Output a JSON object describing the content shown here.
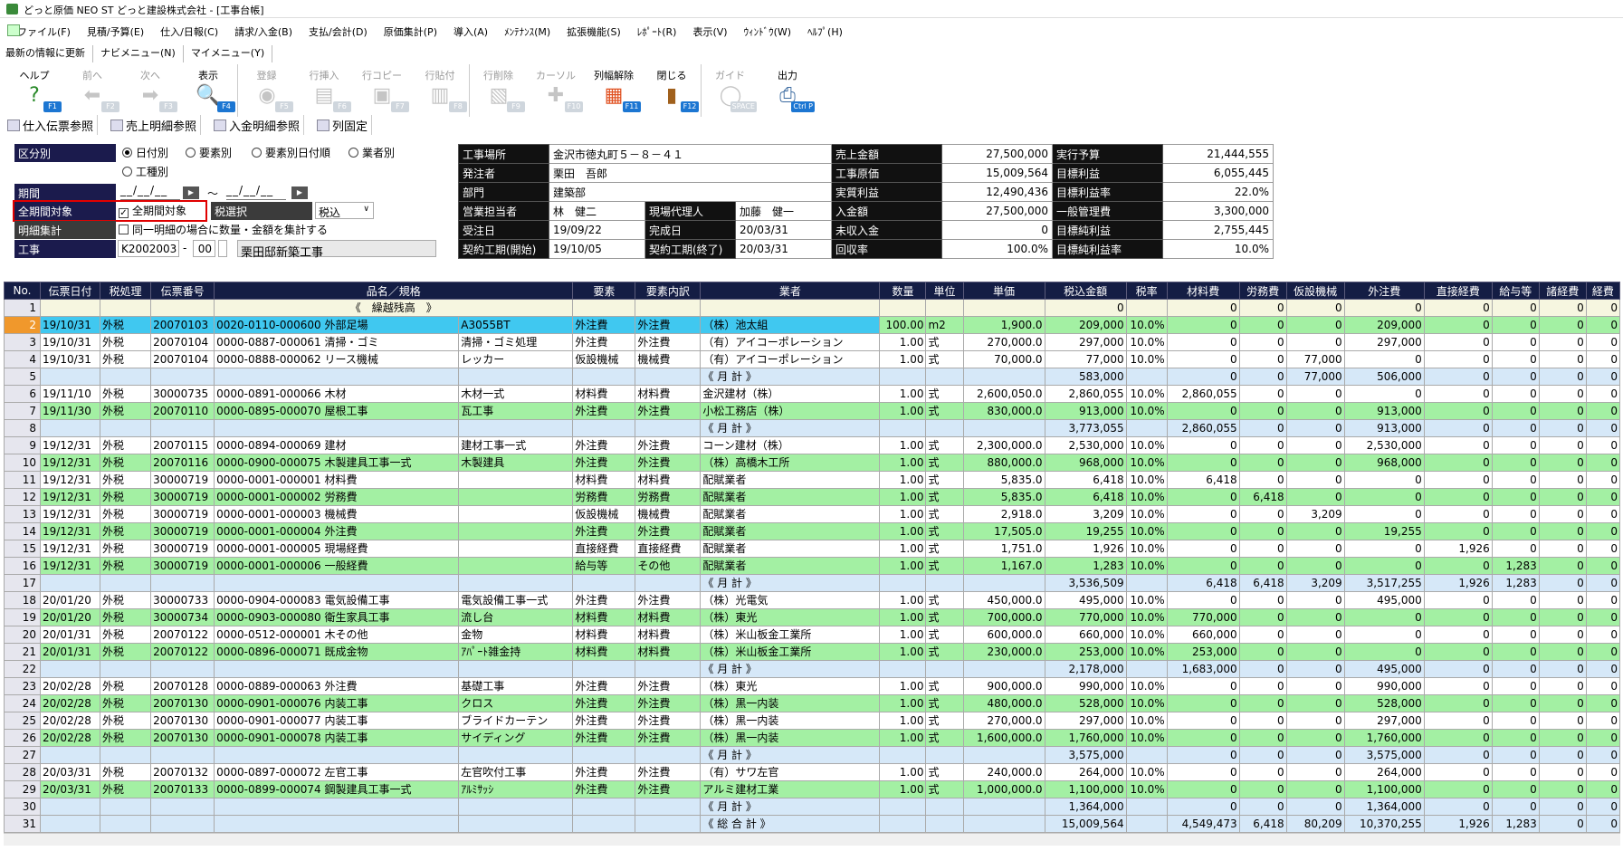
{
  "window": {
    "title": "どっと原価 NEO ST どっと建設株式会社 - [工事台帳]"
  },
  "menu": [
    "ファイル(F)",
    "見積/予算(E)",
    "仕入/日報(C)",
    "請求/入金(B)",
    "支払/会計(D)",
    "原価集計(P)",
    "導入(A)",
    "ﾒﾝﾃﾅﾝｽ(M)",
    "拡張機能(S)",
    "ﾚﾎﾟｰﾄ(R)",
    "表示(V)",
    "ｳｨﾝﾄﾞｳ(W)",
    "ﾍﾙﾌﾟ(H)"
  ],
  "nav": [
    "最新の情報に更新",
    "ナビメニュー(N)",
    "マイメニュー(Y)"
  ],
  "toolbar": [
    {
      "label": "ヘルプ",
      "key": "F1",
      "icon": "help-icon",
      "enabled": true
    },
    {
      "label": "前へ",
      "key": "F2",
      "icon": "back-arrow-icon",
      "enabled": false
    },
    {
      "label": "次へ",
      "key": "F3",
      "icon": "forward-arrow-icon",
      "enabled": false
    },
    {
      "label": "表示",
      "key": "F4",
      "icon": "magnifier-icon",
      "enabled": true
    },
    {
      "label": "登録",
      "key": "F5",
      "icon": "disk-icon",
      "enabled": false
    },
    {
      "label": "行挿入",
      "key": "F6",
      "icon": "row-insert-icon",
      "enabled": false
    },
    {
      "label": "行コピー",
      "key": "F7",
      "icon": "row-copy-icon",
      "enabled": false
    },
    {
      "label": "行貼付",
      "key": "F8",
      "icon": "row-paste-icon",
      "enabled": false
    },
    {
      "label": "行削除",
      "key": "F9",
      "icon": "row-delete-icon",
      "enabled": false
    },
    {
      "label": "カーソル",
      "key": "F10",
      "icon": "cursor-icon",
      "enabled": false
    },
    {
      "label": "列幅解除",
      "key": "F11",
      "icon": "column-width-icon",
      "enabled": true
    },
    {
      "label": "閉じる",
      "key": "F12",
      "icon": "door-icon",
      "enabled": true
    },
    {
      "label": "ガイド",
      "key": "SPACE",
      "icon": "lightbulb-icon",
      "enabled": false
    },
    {
      "label": "出力",
      "key": "Ctrl P",
      "icon": "printer-icon",
      "enabled": true
    }
  ],
  "subbar": [
    "仕入伝票参照",
    "売上明細参照",
    "入金明細参照",
    "列固定"
  ],
  "filters": {
    "kubun_label": "区分別",
    "kubun_options": [
      "日付別",
      "要素別",
      "要素別日付順",
      "業者別",
      "工種別"
    ],
    "kubun_selected": "日付別",
    "kikan_label": "期間",
    "date_from": "__/__/__",
    "date_to": "__/__/__",
    "tilde": "～",
    "zenkikan_label": "全期間対象",
    "zenkikan_check": "全期間対象",
    "zeisentaku_label": "税選択",
    "zeisentaku_value": "税込",
    "meisai_label": "明細集計",
    "meisai_check": "同一明細の場合に数量・金額を集計する",
    "koji_label": "工事",
    "koji_code": "K2002003",
    "koji_dash": "-",
    "koji_sub": "00",
    "koji_name": "栗田邸新築工事"
  },
  "info": {
    "rows": [
      [
        "工事場所",
        "金沢市徳丸町５－８－４１",
        "",
        "",
        "売上金額",
        "27,500,000",
        "実行予算",
        "21,444,555"
      ],
      [
        "発注者",
        "栗田　吾郎",
        "",
        "",
        "工事原価",
        "15,009,564",
        "目標利益",
        "6,055,445"
      ],
      [
        "部門",
        "建築部",
        "",
        "",
        "実質利益",
        "12,490,436",
        "目標利益率",
        "22.0%"
      ],
      [
        "営業担当者",
        "林　健二",
        "現場代理人",
        "加藤　健一",
        "入金額",
        "27,500,000",
        "一般管理費",
        "3,300,000"
      ],
      [
        "受注日",
        "19/09/22",
        "完成日",
        "20/03/31",
        "未収入金",
        "0",
        "目標純利益",
        "2,755,445"
      ],
      [
        "契約工期(開始)",
        "19/10/05",
        "契約工期(終了)",
        "20/03/31",
        "回収率",
        "100.0%",
        "目標純利益率",
        "10.0%"
      ]
    ]
  },
  "grid": {
    "headers": [
      "No.",
      "伝票日付",
      "税処理",
      "伝票番号",
      "品名／規格",
      "",
      "要素",
      "要素内訳",
      "業者",
      "数量",
      "単位",
      "単価",
      "税込金額",
      "税率",
      "材料費",
      "労務費",
      "仮設機械",
      "外注費",
      "直接経費",
      "給与等",
      "諸経費",
      "経費"
    ],
    "rows": [
      {
        "t": "c",
        "v": [
          "1",
          "",
          "",
          "",
          "",
          "《　繰越残高　》",
          "",
          "",
          "",
          "",
          "",
          "",
          "0",
          "",
          "0",
          "0",
          "0",
          "0",
          "0",
          "0",
          "0",
          "0"
        ]
      },
      {
        "t": "sel",
        "v": [
          "2",
          "19/10/31",
          "外税",
          "20070103",
          "0020-0110-000600 外部足場",
          "A3055BT",
          "外注費",
          "外注費",
          "（株）池太組",
          "100.00",
          "m2",
          "1,900.0",
          "209,000",
          "10.0%",
          "0",
          "0",
          "0",
          "209,000",
          "0",
          "0",
          "0",
          "0"
        ]
      },
      {
        "t": "w",
        "v": [
          "3",
          "19/10/31",
          "外税",
          "20070104",
          "0000-0887-000061 清掃・ゴミ",
          "清掃・ゴミ処理",
          "外注費",
          "外注費",
          "（有）アイコーポレーション",
          "1.00",
          "式",
          "270,000.0",
          "297,000",
          "10.0%",
          "0",
          "0",
          "0",
          "297,000",
          "0",
          "0",
          "0",
          "0"
        ]
      },
      {
        "t": "w",
        "v": [
          "4",
          "19/10/31",
          "外税",
          "20070104",
          "0000-0888-000062 リース機械",
          "レッカー",
          "仮設機械",
          "機械費",
          "（有）アイコーポレーション",
          "1.00",
          "式",
          "70,000.0",
          "77,000",
          "10.0%",
          "0",
          "0",
          "77,000",
          "0",
          "0",
          "0",
          "0",
          "0"
        ]
      },
      {
        "t": "s",
        "v": [
          "5",
          "",
          "",
          "",
          "",
          "",
          "",
          "",
          "《 月 計 》",
          "",
          "",
          "",
          "583,000",
          "",
          "0",
          "0",
          "77,000",
          "506,000",
          "0",
          "0",
          "0",
          "0"
        ]
      },
      {
        "t": "w",
        "v": [
          "6",
          "19/11/10",
          "外税",
          "30000735",
          "0000-0891-000066 木材",
          "木材一式",
          "材料費",
          "材料費",
          "金沢建材（株）",
          "1.00",
          "式",
          "2,600,050.0",
          "2,860,055",
          "10.0%",
          "2,860,055",
          "0",
          "0",
          "0",
          "0",
          "0",
          "0",
          "0"
        ]
      },
      {
        "t": "g",
        "v": [
          "7",
          "19/11/30",
          "外税",
          "20070110",
          "0000-0895-000070 屋根工事",
          "瓦工事",
          "外注費",
          "外注費",
          "小松工務店（株）",
          "1.00",
          "式",
          "830,000.0",
          "913,000",
          "10.0%",
          "0",
          "0",
          "0",
          "913,000",
          "0",
          "0",
          "0",
          "0"
        ]
      },
      {
        "t": "s",
        "v": [
          "8",
          "",
          "",
          "",
          "",
          "",
          "",
          "",
          "《 月 計 》",
          "",
          "",
          "",
          "3,773,055",
          "",
          "2,860,055",
          "0",
          "0",
          "913,000",
          "0",
          "0",
          "0",
          "0"
        ]
      },
      {
        "t": "w",
        "v": [
          "9",
          "19/12/31",
          "外税",
          "20070115",
          "0000-0894-000069 建材",
          "建材工事一式",
          "外注費",
          "外注費",
          "コーン建材（株）",
          "1.00",
          "式",
          "2,300,000.0",
          "2,530,000",
          "10.0%",
          "0",
          "0",
          "0",
          "2,530,000",
          "0",
          "0",
          "0",
          "0"
        ]
      },
      {
        "t": "g",
        "v": [
          "10",
          "19/12/31",
          "外税",
          "20070116",
          "0000-0900-000075 木製建具工事一式",
          "木製建具",
          "外注費",
          "外注費",
          "（株）高橋木工所",
          "1.00",
          "式",
          "880,000.0",
          "968,000",
          "10.0%",
          "0",
          "0",
          "0",
          "968,000",
          "0",
          "0",
          "0",
          "0"
        ]
      },
      {
        "t": "w",
        "v": [
          "11",
          "19/12/31",
          "外税",
          "30000719",
          "0000-0001-000001 材料費",
          "",
          "材料費",
          "材料費",
          "配賦業者",
          "1.00",
          "式",
          "5,835.0",
          "6,418",
          "10.0%",
          "6,418",
          "0",
          "0",
          "0",
          "0",
          "0",
          "0",
          "0"
        ]
      },
      {
        "t": "g",
        "v": [
          "12",
          "19/12/31",
          "外税",
          "30000719",
          "0000-0001-000002 労務費",
          "",
          "労務費",
          "労務費",
          "配賦業者",
          "1.00",
          "式",
          "5,835.0",
          "6,418",
          "10.0%",
          "0",
          "6,418",
          "0",
          "0",
          "0",
          "0",
          "0",
          "0"
        ]
      },
      {
        "t": "w",
        "v": [
          "13",
          "19/12/31",
          "外税",
          "30000719",
          "0000-0001-000003 機械費",
          "",
          "仮設機械",
          "機械費",
          "配賦業者",
          "1.00",
          "式",
          "2,918.0",
          "3,209",
          "10.0%",
          "0",
          "0",
          "3,209",
          "0",
          "0",
          "0",
          "0",
          "0"
        ]
      },
      {
        "t": "g",
        "v": [
          "14",
          "19/12/31",
          "外税",
          "30000719",
          "0000-0001-000004 外注費",
          "",
          "外注費",
          "外注費",
          "配賦業者",
          "1.00",
          "式",
          "17,505.0",
          "19,255",
          "10.0%",
          "0",
          "0",
          "0",
          "19,255",
          "0",
          "0",
          "0",
          "0"
        ]
      },
      {
        "t": "w",
        "v": [
          "15",
          "19/12/31",
          "外税",
          "30000719",
          "0000-0001-000005 現場経費",
          "",
          "直接経費",
          "直接経費",
          "配賦業者",
          "1.00",
          "式",
          "1,751.0",
          "1,926",
          "10.0%",
          "0",
          "0",
          "0",
          "0",
          "1,926",
          "0",
          "0",
          "0"
        ]
      },
      {
        "t": "g",
        "v": [
          "16",
          "19/12/31",
          "外税",
          "30000719",
          "0000-0001-000006 一般経費",
          "",
          "給与等",
          "その他",
          "配賦業者",
          "1.00",
          "式",
          "1,167.0",
          "1,283",
          "10.0%",
          "0",
          "0",
          "0",
          "0",
          "0",
          "1,283",
          "0",
          "0"
        ]
      },
      {
        "t": "s",
        "v": [
          "17",
          "",
          "",
          "",
          "",
          "",
          "",
          "",
          "《 月 計 》",
          "",
          "",
          "",
          "3,536,509",
          "",
          "6,418",
          "6,418",
          "3,209",
          "3,517,255",
          "1,926",
          "1,283",
          "0",
          "0"
        ]
      },
      {
        "t": "w",
        "v": [
          "18",
          "20/01/20",
          "外税",
          "30000733",
          "0000-0904-000083 電気設備工事",
          "電気設備工事一式",
          "外注費",
          "外注費",
          "（株）光電気",
          "1.00",
          "式",
          "450,000.0",
          "495,000",
          "10.0%",
          "0",
          "0",
          "0",
          "495,000",
          "0",
          "0",
          "0",
          "0"
        ]
      },
      {
        "t": "g",
        "v": [
          "19",
          "20/01/20",
          "外税",
          "30000734",
          "0000-0903-000080 衛生家具工事",
          "流し台",
          "材料費",
          "材料費",
          "（株）東光",
          "1.00",
          "式",
          "700,000.0",
          "770,000",
          "10.0%",
          "770,000",
          "0",
          "0",
          "0",
          "0",
          "0",
          "0",
          "0"
        ]
      },
      {
        "t": "w",
        "v": [
          "20",
          "20/01/31",
          "外税",
          "20070122",
          "0000-0512-000001 木その他",
          "金物",
          "材料費",
          "材料費",
          "（株）米山板金工業所",
          "1.00",
          "式",
          "600,000.0",
          "660,000",
          "10.0%",
          "660,000",
          "0",
          "0",
          "0",
          "0",
          "0",
          "0",
          "0"
        ]
      },
      {
        "t": "g",
        "v": [
          "21",
          "20/01/31",
          "外税",
          "20070122",
          "0000-0896-000071 既成金物",
          "ｱﾊﾟｰﾄ雑金持",
          "材料費",
          "材料費",
          "（株）米山板金工業所",
          "1.00",
          "式",
          "230,000.0",
          "253,000",
          "10.0%",
          "253,000",
          "0",
          "0",
          "0",
          "0",
          "0",
          "0",
          "0"
        ]
      },
      {
        "t": "s",
        "v": [
          "22",
          "",
          "",
          "",
          "",
          "",
          "",
          "",
          "《 月 計 》",
          "",
          "",
          "",
          "2,178,000",
          "",
          "1,683,000",
          "0",
          "0",
          "495,000",
          "0",
          "0",
          "0",
          "0"
        ]
      },
      {
        "t": "w",
        "v": [
          "23",
          "20/02/28",
          "外税",
          "20070128",
          "0000-0889-000063 外注費",
          "基礎工事",
          "外注費",
          "外注費",
          "（株）東光",
          "1.00",
          "式",
          "900,000.0",
          "990,000",
          "10.0%",
          "0",
          "0",
          "0",
          "990,000",
          "0",
          "0",
          "0",
          "0"
        ]
      },
      {
        "t": "g",
        "v": [
          "24",
          "20/02/28",
          "外税",
          "20070130",
          "0000-0901-000076 内装工事",
          "クロス",
          "外注費",
          "外注費",
          "（株）黒一内装",
          "1.00",
          "式",
          "480,000.0",
          "528,000",
          "10.0%",
          "0",
          "0",
          "0",
          "528,000",
          "0",
          "0",
          "0",
          "0"
        ]
      },
      {
        "t": "w",
        "v": [
          "25",
          "20/02/28",
          "外税",
          "20070130",
          "0000-0901-000077 内装工事",
          "ブライドカーテン",
          "外注費",
          "外注費",
          "（株）黒一内装",
          "1.00",
          "式",
          "270,000.0",
          "297,000",
          "10.0%",
          "0",
          "0",
          "0",
          "297,000",
          "0",
          "0",
          "0",
          "0"
        ]
      },
      {
        "t": "g",
        "v": [
          "26",
          "20/02/28",
          "外税",
          "20070130",
          "0000-0901-000078 内装工事",
          "サイディング",
          "外注費",
          "外注費",
          "（株）黒一内装",
          "1.00",
          "式",
          "1,600,000.0",
          "1,760,000",
          "10.0%",
          "0",
          "0",
          "0",
          "1,760,000",
          "0",
          "0",
          "0",
          "0"
        ]
      },
      {
        "t": "s",
        "v": [
          "27",
          "",
          "",
          "",
          "",
          "",
          "",
          "",
          "《 月 計 》",
          "",
          "",
          "",
          "3,575,000",
          "",
          "0",
          "0",
          "0",
          "3,575,000",
          "0",
          "0",
          "0",
          "0"
        ]
      },
      {
        "t": "w",
        "v": [
          "28",
          "20/03/31",
          "外税",
          "20070132",
          "0000-0897-000072 左官工事",
          "左官吹付工事",
          "外注費",
          "外注費",
          "（有）サワ左官",
          "1.00",
          "式",
          "240,000.0",
          "264,000",
          "10.0%",
          "0",
          "0",
          "0",
          "264,000",
          "0",
          "0",
          "0",
          "0"
        ]
      },
      {
        "t": "g",
        "v": [
          "29",
          "20/03/31",
          "外税",
          "20070133",
          "0000-0899-000074 鋼製建具工事一式",
          "ｱﾙﾐｻｯｼ",
          "外注費",
          "外注費",
          "アルミ建材工業",
          "1.00",
          "式",
          "1,000,000.0",
          "1,100,000",
          "10.0%",
          "0",
          "0",
          "0",
          "1,100,000",
          "0",
          "0",
          "0",
          "0"
        ]
      },
      {
        "t": "s",
        "v": [
          "30",
          "",
          "",
          "",
          "",
          "",
          "",
          "",
          "《 月 計 》",
          "",
          "",
          "",
          "1,364,000",
          "",
          "0",
          "0",
          "0",
          "1,364,000",
          "0",
          "0",
          "0",
          "0"
        ]
      },
      {
        "t": "s",
        "v": [
          "31",
          "",
          "",
          "",
          "",
          "",
          "",
          "",
          "《 総 合 計 》",
          "",
          "",
          "",
          "15,009,564",
          "",
          "4,549,473",
          "6,418",
          "80,209",
          "10,370,255",
          "1,926",
          "1,283",
          "0",
          "0"
        ]
      }
    ]
  },
  "colors": {
    "header_bg": "#141d44",
    "green_row": "#a3f0a3",
    "subtotal_row": "#d6e8f8",
    "selected_cell": "#40c8f0",
    "row_marker": "#f0982c",
    "highlight_border": "#e00000"
  }
}
